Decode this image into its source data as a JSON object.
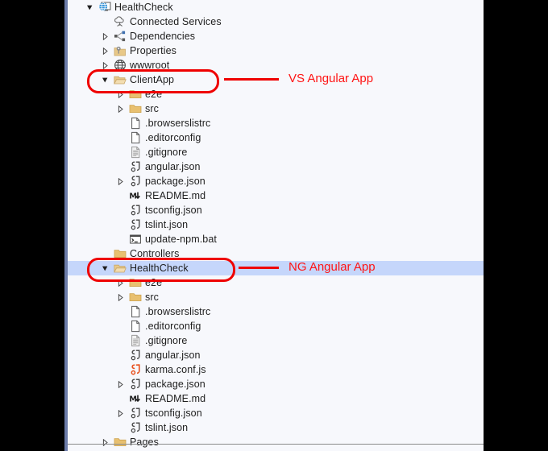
{
  "panel": {
    "name": "solution-explorer-tree",
    "background": "#f7f8fc",
    "selection_color": "#c5d6fb",
    "annotation_color": "#ff1414"
  },
  "tree": {
    "rows": [
      {
        "label": "HealthCheck",
        "depth": 0,
        "icon": "web-project-icon",
        "expander": "expanded",
        "selected": false
      },
      {
        "label": "Connected Services",
        "depth": 1,
        "icon": "connected-services-icon",
        "expander": "none",
        "selected": false
      },
      {
        "label": "Dependencies",
        "depth": 1,
        "icon": "dependencies-icon",
        "expander": "collapsed",
        "selected": false
      },
      {
        "label": "Properties",
        "depth": 1,
        "icon": "properties-folder-icon",
        "expander": "collapsed",
        "selected": false
      },
      {
        "label": "wwwroot",
        "depth": 1,
        "icon": "globe-icon",
        "expander": "collapsed",
        "selected": false
      },
      {
        "label": "ClientApp",
        "depth": 1,
        "icon": "open-folder-icon",
        "expander": "expanded",
        "selected": false
      },
      {
        "label": "e2e",
        "depth": 2,
        "icon": "folder-icon",
        "expander": "collapsed",
        "selected": false
      },
      {
        "label": "src",
        "depth": 2,
        "icon": "folder-icon",
        "expander": "collapsed",
        "selected": false
      },
      {
        "label": ".browserslistrc",
        "depth": 2,
        "icon": "file-icon",
        "expander": "none",
        "selected": false
      },
      {
        "label": ".editorconfig",
        "depth": 2,
        "icon": "file-icon",
        "expander": "none",
        "selected": false
      },
      {
        "label": ".gitignore",
        "depth": 2,
        "icon": "text-file-icon",
        "expander": "none",
        "selected": false
      },
      {
        "label": "angular.json",
        "depth": 2,
        "icon": "json-icon",
        "expander": "none",
        "selected": false
      },
      {
        "label": "package.json",
        "depth": 2,
        "icon": "json-icon",
        "expander": "collapsed",
        "selected": false
      },
      {
        "label": "README.md",
        "depth": 2,
        "icon": "markdown-icon",
        "expander": "none",
        "selected": false
      },
      {
        "label": "tsconfig.json",
        "depth": 2,
        "icon": "json-icon",
        "expander": "none",
        "selected": false
      },
      {
        "label": "tslint.json",
        "depth": 2,
        "icon": "json-icon",
        "expander": "none",
        "selected": false
      },
      {
        "label": "update-npm.bat",
        "depth": 2,
        "icon": "console-icon",
        "expander": "none",
        "selected": false
      },
      {
        "label": "Controllers",
        "depth": 1,
        "icon": "folder-icon",
        "expander": "none",
        "selected": false
      },
      {
        "label": "HealthCheck",
        "depth": 1,
        "icon": "open-folder-icon",
        "expander": "expanded",
        "selected": true
      },
      {
        "label": "e2e",
        "depth": 2,
        "icon": "folder-icon",
        "expander": "collapsed",
        "selected": false
      },
      {
        "label": "src",
        "depth": 2,
        "icon": "folder-icon",
        "expander": "collapsed",
        "selected": false
      },
      {
        "label": ".browserslistrc",
        "depth": 2,
        "icon": "file-icon",
        "expander": "none",
        "selected": false
      },
      {
        "label": ".editorconfig",
        "depth": 2,
        "icon": "file-icon",
        "expander": "none",
        "selected": false
      },
      {
        "label": ".gitignore",
        "depth": 2,
        "icon": "text-file-icon",
        "expander": "none",
        "selected": false
      },
      {
        "label": "angular.json",
        "depth": 2,
        "icon": "json-icon",
        "expander": "none",
        "selected": false
      },
      {
        "label": "karma.conf.js",
        "depth": 2,
        "icon": "js-icon",
        "expander": "none",
        "selected": false
      },
      {
        "label": "package.json",
        "depth": 2,
        "icon": "json-icon",
        "expander": "collapsed",
        "selected": false
      },
      {
        "label": "README.md",
        "depth": 2,
        "icon": "markdown-icon",
        "expander": "none",
        "selected": false
      },
      {
        "label": "tsconfig.json",
        "depth": 2,
        "icon": "json-icon",
        "expander": "collapsed",
        "selected": false
      },
      {
        "label": "tslint.json",
        "depth": 2,
        "icon": "json-icon",
        "expander": "none",
        "selected": false
      },
      {
        "label": "Pages",
        "depth": 1,
        "icon": "folder-icon",
        "expander": "collapsed",
        "selected": false
      }
    ]
  },
  "annotations": [
    {
      "name": "vs-angular-app-callout",
      "text": "VS Angular App",
      "target_row": 5
    },
    {
      "name": "ng-angular-app-callout",
      "text": "NG Angular App",
      "target_row": 18
    }
  ]
}
